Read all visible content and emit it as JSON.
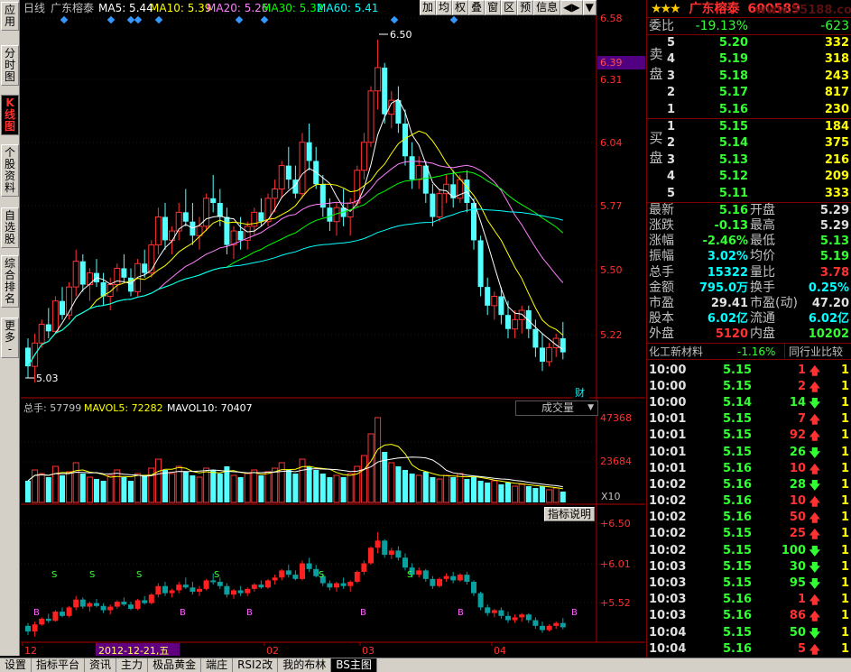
{
  "left_tabs": [
    {
      "label": "应\n用",
      "active": false
    },
    {
      "label": "分\n时\n图",
      "active": false
    },
    {
      "label": "K\n线\n图",
      "active": true
    },
    {
      "label": "个\n股\n资\n料",
      "active": false
    },
    {
      "label": "自\n选\n股",
      "active": false
    },
    {
      "label": "综\n合\n排\n名",
      "active": false
    },
    {
      "label": "更\n多\n-",
      "active": false
    }
  ],
  "header": {
    "period": "日线",
    "stock_name": "广东榕泰",
    "ma5": "MA5: 5.44",
    "ma10": "MA10: 5.39",
    "ma20": "MA20: 5.26",
    "ma30": "MA30: 5.32",
    "ma60": "MA60: 5.41"
  },
  "toolbar": [
    "加",
    "均",
    "权",
    "叠",
    "窗",
    "区",
    "预",
    "信息",
    "◀▶",
    "▼"
  ],
  "price_axis": {
    "labels": [
      "6.58",
      "6.31",
      "6.04",
      "5.77",
      "5.50",
      "5.22"
    ],
    "current": "6.39",
    "high_label": "6.50",
    "low_label": "5.03",
    "cai_label": "财"
  },
  "volume": {
    "header_total": "总手: 57799",
    "header_mavol5": "MAVOL5: 72282",
    "header_mavol10": "MAVOL10: 70407",
    "dropdown": "成交量",
    "axis": [
      "47368",
      "23684"
    ],
    "unit": "X10"
  },
  "indicator": {
    "button": "指标说明",
    "axis": [
      "+6.50",
      "+6.01",
      "+5.52"
    ]
  },
  "date_axis": {
    "labels": [
      "12",
      "2012-12-21,五",
      "02",
      "03",
      "04"
    ]
  },
  "bottom_tabs": [
    "设置",
    "指标平台",
    "资讯",
    "主力",
    "极品黄金",
    "端庄",
    "RSI2改",
    "我的布林",
    "BS主图"
  ],
  "watermark": "www.55188.com",
  "quote": {
    "name": "广东榕泰",
    "code": "600589",
    "webi_label": "委比",
    "webi_pct": "-19.13%",
    "webi_diff": "-623",
    "sell_side": "卖\n盘",
    "buy_side": "买\n盘",
    "sell": [
      {
        "lvl": "5",
        "price": "5.20",
        "vol": "332"
      },
      {
        "lvl": "4",
        "price": "5.19",
        "vol": "318"
      },
      {
        "lvl": "3",
        "price": "5.18",
        "vol": "243"
      },
      {
        "lvl": "2",
        "price": "5.17",
        "vol": "817"
      },
      {
        "lvl": "1",
        "price": "5.16",
        "vol": "230"
      }
    ],
    "buy": [
      {
        "lvl": "1",
        "price": "5.15",
        "vol": "184"
      },
      {
        "lvl": "2",
        "price": "5.14",
        "vol": "375"
      },
      {
        "lvl": "3",
        "price": "5.13",
        "vol": "216"
      },
      {
        "lvl": "4",
        "price": "5.12",
        "vol": "209"
      },
      {
        "lvl": "5",
        "price": "5.11",
        "vol": "333"
      }
    ],
    "stats": [
      {
        "l1": "最新",
        "v1": "5.16",
        "c1": "grn",
        "l2": "开盘",
        "v2": "5.29",
        "c2": "wht"
      },
      {
        "l1": "涨跌",
        "v1": "-0.13",
        "c1": "grn",
        "l2": "最高",
        "v2": "5.29",
        "c2": "wht"
      },
      {
        "l1": "涨幅",
        "v1": "-2.46%",
        "c1": "grn",
        "l2": "最低",
        "v2": "5.13",
        "c2": "grn"
      },
      {
        "l1": "振幅",
        "v1": "3.02%",
        "c1": "cyan",
        "l2": "均价",
        "v2": "5.19",
        "c2": "grn"
      },
      {
        "l1": "总手",
        "v1": "15322",
        "c1": "cyan",
        "l2": "量比",
        "v2": "3.78",
        "c2": "red"
      },
      {
        "l1": "金额",
        "v1": "795.0万",
        "c1": "cyan",
        "l2": "换手",
        "v2": "0.25%",
        "c2": "cyan"
      },
      {
        "l1": "市盈",
        "v1": "29.41",
        "c1": "wht",
        "l2": "市盈(动)",
        "v2": "47.20",
        "c2": "wht"
      },
      {
        "l1": "股本",
        "v1": "6.02亿",
        "c1": "cyan",
        "l2": "流通",
        "v2": "6.02亿",
        "c2": "cyan"
      },
      {
        "l1": "外盘",
        "v1": "5120",
        "c1": "red",
        "l2": "内盘",
        "v2": "10202",
        "c2": "grn"
      }
    ],
    "industry": "化工新材料",
    "industry_pct": "-1.16%",
    "compare_btn": "同行业比较"
  },
  "ticks": [
    {
      "t": "10:00",
      "p": "5.15",
      "v": "1",
      "d": "up",
      "n": "1"
    },
    {
      "t": "10:00",
      "p": "5.15",
      "v": "2",
      "d": "up",
      "n": "1"
    },
    {
      "t": "10:00",
      "p": "5.14",
      "v": "14",
      "d": "down",
      "n": "1"
    },
    {
      "t": "10:01",
      "p": "5.15",
      "v": "7",
      "d": "up",
      "n": "1"
    },
    {
      "t": "10:01",
      "p": "5.15",
      "v": "92",
      "d": "up",
      "n": "1"
    },
    {
      "t": "10:01",
      "p": "5.15",
      "v": "26",
      "d": "down",
      "n": "1"
    },
    {
      "t": "10:01",
      "p": "5.16",
      "v": "10",
      "d": "up",
      "n": "1"
    },
    {
      "t": "10:02",
      "p": "5.16",
      "v": "28",
      "d": "down",
      "n": "1"
    },
    {
      "t": "10:02",
      "p": "5.16",
      "v": "10",
      "d": "up",
      "n": "1"
    },
    {
      "t": "10:02",
      "p": "5.16",
      "v": "50",
      "d": "up",
      "n": "1"
    },
    {
      "t": "10:02",
      "p": "5.15",
      "v": "25",
      "d": "up",
      "n": "1"
    },
    {
      "t": "10:02",
      "p": "5.15",
      "v": "100",
      "d": "down",
      "n": "1"
    },
    {
      "t": "10:03",
      "p": "5.15",
      "v": "30",
      "d": "down",
      "n": "1"
    },
    {
      "t": "10:03",
      "p": "5.15",
      "v": "95",
      "d": "down",
      "n": "1"
    },
    {
      "t": "10:03",
      "p": "5.16",
      "v": "1",
      "d": "up",
      "n": "1"
    },
    {
      "t": "10:03",
      "p": "5.16",
      "v": "86",
      "d": "up",
      "n": "1"
    },
    {
      "t": "10:04",
      "p": "5.15",
      "v": "50",
      "d": "down",
      "n": "1"
    },
    {
      "t": "10:04",
      "p": "5.16",
      "v": "5",
      "d": "up",
      "n": "1"
    },
    {
      "t": "10:04",
      "p": "5.16",
      "v": "37",
      "d": "up",
      "n": "1"
    }
  ],
  "right_bottom_tabs": [
    "细",
    "诊",
    "分",
    "筹",
    "焰",
    "指",
    "财"
  ],
  "chart_data": {
    "type": "candlestick",
    "ylim": [
      5.0,
      6.6
    ],
    "candles": [
      [
        5.18,
        5.22,
        5.05,
        5.1
      ],
      [
        5.1,
        5.24,
        5.03,
        5.2
      ],
      [
        5.2,
        5.3,
        5.18,
        5.28
      ],
      [
        5.28,
        5.35,
        5.22,
        5.25
      ],
      [
        5.25,
        5.4,
        5.24,
        5.38
      ],
      [
        5.38,
        5.44,
        5.3,
        5.32
      ],
      [
        5.32,
        5.46,
        5.3,
        5.44
      ],
      [
        5.44,
        5.6,
        5.4,
        5.55
      ],
      [
        5.55,
        5.58,
        5.42,
        5.45
      ],
      [
        5.45,
        5.52,
        5.38,
        5.5
      ],
      [
        5.5,
        5.56,
        5.44,
        5.46
      ],
      [
        5.46,
        5.5,
        5.36,
        5.4
      ],
      [
        5.4,
        5.48,
        5.34,
        5.45
      ],
      [
        5.45,
        5.54,
        5.42,
        5.52
      ],
      [
        5.52,
        5.58,
        5.46,
        5.48
      ],
      [
        5.48,
        5.52,
        5.4,
        5.42
      ],
      [
        5.42,
        5.56,
        5.4,
        5.54
      ],
      [
        5.54,
        5.6,
        5.48,
        5.5
      ],
      [
        5.5,
        5.64,
        5.48,
        5.62
      ],
      [
        5.62,
        5.78,
        5.58,
        5.74
      ],
      [
        5.74,
        5.8,
        5.6,
        5.64
      ],
      [
        5.64,
        5.7,
        5.58,
        5.68
      ],
      [
        5.68,
        5.8,
        5.64,
        5.76
      ],
      [
        5.76,
        5.86,
        5.7,
        5.72
      ],
      [
        5.72,
        5.8,
        5.62,
        5.66
      ],
      [
        5.66,
        5.74,
        5.6,
        5.7
      ],
      [
        5.7,
        5.84,
        5.68,
        5.82
      ],
      [
        5.82,
        5.92,
        5.76,
        5.8
      ],
      [
        5.8,
        5.86,
        5.7,
        5.74
      ],
      [
        5.74,
        5.78,
        5.58,
        5.62
      ],
      [
        5.62,
        5.7,
        5.56,
        5.68
      ],
      [
        5.68,
        5.74,
        5.6,
        5.64
      ],
      [
        5.64,
        5.72,
        5.6,
        5.7
      ],
      [
        5.7,
        5.78,
        5.66,
        5.76
      ],
      [
        5.76,
        5.82,
        5.7,
        5.72
      ],
      [
        5.72,
        5.84,
        5.7,
        5.82
      ],
      [
        5.82,
        5.9,
        5.76,
        5.86
      ],
      [
        5.86,
        5.98,
        5.82,
        5.96
      ],
      [
        5.96,
        6.04,
        5.86,
        5.9
      ],
      [
        5.9,
        5.96,
        5.82,
        5.84
      ],
      [
        5.84,
        6.1,
        5.82,
        6.06
      ],
      [
        6.06,
        6.14,
        5.94,
        5.98
      ],
      [
        5.98,
        6.04,
        5.86,
        5.88
      ],
      [
        5.88,
        5.92,
        5.74,
        5.78
      ],
      [
        5.78,
        5.82,
        5.68,
        5.72
      ],
      [
        5.72,
        5.8,
        5.66,
        5.78
      ],
      [
        5.78,
        5.86,
        5.7,
        5.74
      ],
      [
        5.74,
        5.82,
        5.66,
        5.8
      ],
      [
        5.8,
        5.96,
        5.78,
        5.94
      ],
      [
        5.94,
        6.1,
        5.9,
        6.06
      ],
      [
        6.06,
        6.3,
        6.04,
        6.28
      ],
      [
        6.28,
        6.5,
        6.2,
        6.38
      ],
      [
        6.38,
        6.4,
        6.14,
        6.18
      ],
      [
        6.18,
        6.28,
        6.12,
        6.24
      ],
      [
        6.24,
        6.3,
        6.1,
        6.14
      ],
      [
        6.14,
        6.2,
        5.96,
        6.0
      ],
      [
        6.0,
        6.06,
        5.86,
        5.9
      ],
      [
        5.9,
        6.0,
        5.86,
        5.96
      ],
      [
        5.96,
        5.98,
        5.8,
        5.84
      ],
      [
        5.84,
        5.88,
        5.7,
        5.74
      ],
      [
        5.74,
        5.86,
        5.72,
        5.84
      ],
      [
        5.84,
        5.92,
        5.8,
        5.88
      ],
      [
        5.88,
        5.94,
        5.78,
        5.82
      ],
      [
        5.82,
        5.92,
        5.8,
        5.9
      ],
      [
        5.9,
        5.94,
        5.76,
        5.8
      ],
      [
        5.8,
        5.82,
        5.6,
        5.64
      ],
      [
        5.64,
        5.66,
        5.4,
        5.44
      ],
      [
        5.44,
        5.48,
        5.32,
        5.36
      ],
      [
        5.36,
        5.42,
        5.3,
        5.4
      ],
      [
        5.4,
        5.44,
        5.28,
        5.32
      ],
      [
        5.32,
        5.38,
        5.22,
        5.26
      ],
      [
        5.26,
        5.34,
        5.22,
        5.3
      ],
      [
        5.3,
        5.36,
        5.24,
        5.34
      ],
      [
        5.34,
        5.36,
        5.22,
        5.26
      ],
      [
        5.26,
        5.3,
        5.14,
        5.18
      ],
      [
        5.18,
        5.24,
        5.08,
        5.12
      ],
      [
        5.12,
        5.2,
        5.1,
        5.18
      ],
      [
        5.18,
        5.24,
        5.14,
        5.22
      ],
      [
        5.22,
        5.29,
        5.13,
        5.16
      ]
    ],
    "volumes": [
      12,
      18,
      16,
      14,
      20,
      15,
      17,
      22,
      16,
      14,
      13,
      12,
      15,
      18,
      14,
      12,
      16,
      15,
      19,
      24,
      18,
      16,
      20,
      17,
      15,
      14,
      19,
      18,
      16,
      20,
      15,
      14,
      16,
      18,
      15,
      17,
      19,
      22,
      18,
      16,
      24,
      20,
      18,
      16,
      14,
      15,
      14,
      16,
      20,
      26,
      38,
      47,
      28,
      22,
      20,
      18,
      16,
      15,
      17,
      14,
      13,
      15,
      14,
      16,
      13,
      14,
      12,
      11,
      12,
      10,
      11,
      9,
      10,
      9,
      8,
      9,
      7,
      8,
      6
    ]
  }
}
